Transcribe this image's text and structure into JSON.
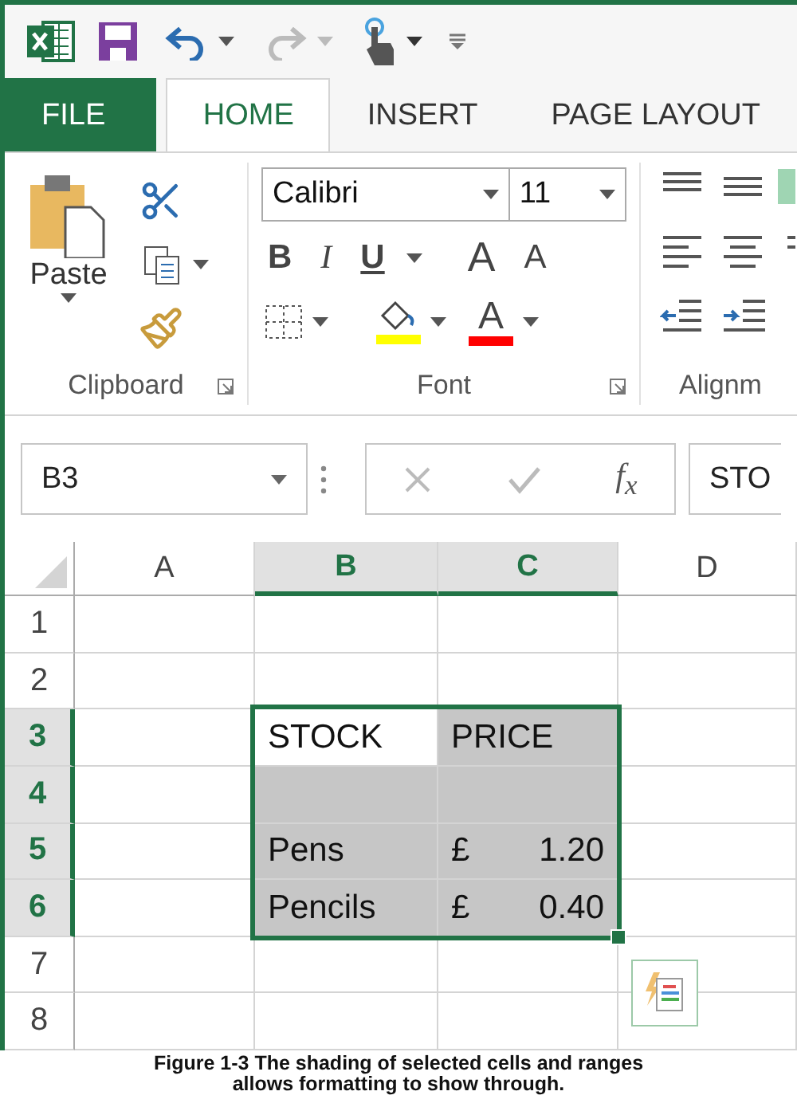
{
  "ribbon_tabs": [
    {
      "label": "FILE",
      "kind": "file",
      "selected": false
    },
    {
      "label": "HOME",
      "kind": "tab",
      "selected": true
    },
    {
      "label": "INSERT",
      "kind": "tab",
      "selected": false
    },
    {
      "label": "PAGE LAYOUT",
      "kind": "tab",
      "selected": false
    }
  ],
  "clipboard": {
    "paste": "Paste",
    "label": "Clipboard"
  },
  "font_group": {
    "font_name": "Calibri",
    "font_size": "11",
    "bold": "B",
    "italic": "I",
    "underline": "U",
    "grow": "A",
    "shrink": "A",
    "font_color": "A",
    "label": "Font"
  },
  "alignment_group": {
    "label": "Alignm"
  },
  "formula_bar": {
    "name_box": "B3",
    "function": "f$_{x}$",
    "content": "STO"
  },
  "columns": [
    {
      "label": "A",
      "selected": false
    },
    {
      "label": "B",
      "selected": true
    },
    {
      "label": "C",
      "selected": true
    },
    {
      "label": "D",
      "selected": false
    }
  ],
  "rows": [
    {
      "label": "1",
      "selected": false,
      "cells": [
        {
          "text": "",
          "selected": false
        },
        {
          "text": "",
          "selected": false
        },
        {
          "text": "",
          "selected": false
        },
        {
          "text": "",
          "selected": false
        }
      ]
    },
    {
      "label": "2",
      "selected": false,
      "cells": [
        {
          "text": "",
          "selected": false
        },
        {
          "text": "",
          "selected": false
        },
        {
          "text": "",
          "selected": false
        },
        {
          "text": "",
          "selected": false
        }
      ]
    },
    {
      "label": "3",
      "selected": true,
      "cells": [
        {
          "text": "",
          "selected": false
        },
        {
          "text": "STOCK",
          "selected": true,
          "active": true
        },
        {
          "text": "PRICE",
          "selected": true
        },
        {
          "text": "",
          "selected": false
        }
      ]
    },
    {
      "label": "4",
      "selected": true,
      "cells": [
        {
          "text": "",
          "selected": false
        },
        {
          "text": "",
          "selected": true
        },
        {
          "text": "",
          "selected": true
        },
        {
          "text": "",
          "selected": false
        }
      ]
    },
    {
      "label": "5",
      "selected": true,
      "cells": [
        {
          "text": "",
          "selected": false
        },
        {
          "text": "Pens",
          "selected": true
        },
        {
          "symbol": "£",
          "text": "1.20",
          "selected": true
        },
        {
          "text": "",
          "selected": false
        }
      ]
    },
    {
      "label": "6",
      "selected": true,
      "cells": [
        {
          "text": "",
          "selected": false
        },
        {
          "text": "Pencils",
          "selected": true
        },
        {
          "symbol": "£",
          "text": "0.40",
          "selected": true
        },
        {
          "text": "",
          "selected": false
        }
      ]
    },
    {
      "label": "7",
      "selected": false,
      "cells": [
        {
          "text": "",
          "selected": false
        },
        {
          "text": "",
          "selected": false
        },
        {
          "text": "",
          "selected": false
        },
        {
          "text": "",
          "selected": false
        }
      ]
    },
    {
      "label": "8",
      "selected": false,
      "cells": [
        {
          "text": "",
          "selected": false
        },
        {
          "text": "",
          "selected": false
        },
        {
          "text": "",
          "selected": false
        },
        {
          "text": "",
          "selected": false
        }
      ]
    }
  ],
  "caption": "Figure 1-3 The shading of selected cells and ranges allows formatting to show through."
}
